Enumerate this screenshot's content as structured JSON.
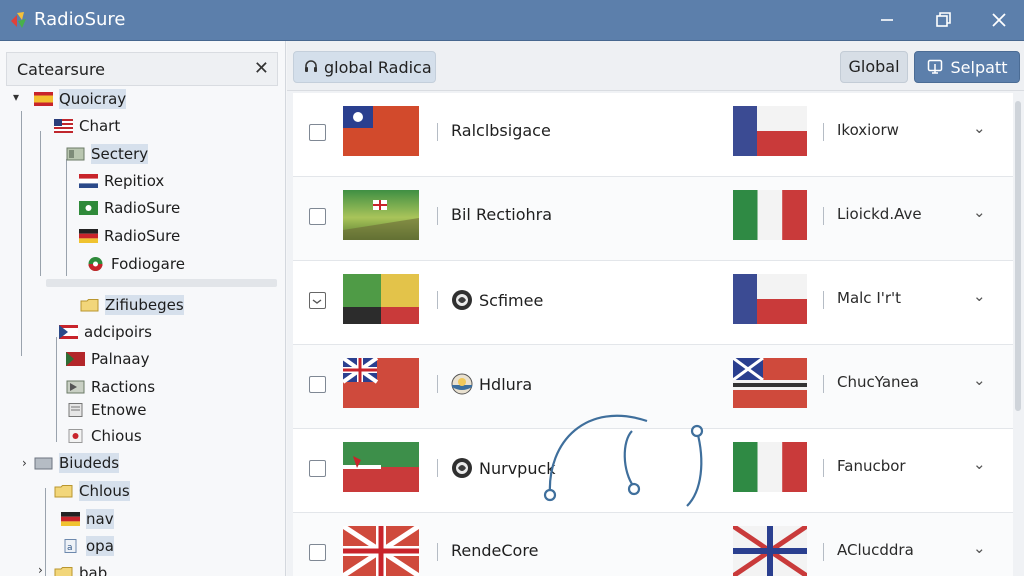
{
  "window": {
    "title": "RadioSure",
    "controls": [
      "minimize-icon",
      "restore-icon",
      "close-icon"
    ]
  },
  "sidebar": {
    "title": "Catearsure",
    "close_label": "✕",
    "items": [
      {
        "label": "Quoicray",
        "icon": "flag-es-icon"
      },
      {
        "label": "Chart",
        "icon": "flag-us-icon"
      },
      {
        "label": "Sectery",
        "icon": "folder-icon"
      },
      {
        "label": "Repitiox",
        "icon": "flag-nl-icon"
      },
      {
        "label": "RadioSure",
        "icon": "flag-green-icon"
      },
      {
        "label": "RadioSure",
        "icon": "flag-de-icon"
      },
      {
        "label": "Fodiogare",
        "icon": "flag-circle-icon"
      },
      {
        "label": "Zifiubeges",
        "icon": "folder-icon"
      },
      {
        "label": "adcipoirs",
        "icon": "flag-pr-icon"
      },
      {
        "label": "Palnaay",
        "icon": "flag-red-icon"
      },
      {
        "label": "Ractions",
        "icon": "folder-icon"
      },
      {
        "label": "Etnowe",
        "icon": "doc-icon"
      },
      {
        "label": "Chious",
        "icon": "doc-icon"
      },
      {
        "label": "Biudeds",
        "icon": "folder-icon"
      },
      {
        "label": "Chlous",
        "icon": "folder-icon"
      },
      {
        "label": "nav",
        "icon": "flag-de-icon"
      },
      {
        "label": "opa",
        "icon": "doc-icon"
      },
      {
        "label": "bab",
        "icon": "folder-icon"
      }
    ]
  },
  "toolbar": {
    "search_label": "global Radica",
    "global_label": "Global",
    "select_label": "Selpatt"
  },
  "stations": [
    {
      "name": "Ralclbsigace",
      "lang": "Ikoxiorw",
      "checked": false
    },
    {
      "name": "Bil Rectiohra",
      "lang": "Lioickd.Ave",
      "checked": false
    },
    {
      "name": "Scfimee",
      "lang": "Malc I'r't",
      "checked": "partial"
    },
    {
      "name": "Hdlura",
      "lang": "ChucYanea",
      "checked": false
    },
    {
      "name": "Nurvpuck",
      "lang": "Fanucbor",
      "checked": false
    },
    {
      "name": "RendeCore",
      "lang": "AClucddra",
      "checked": false
    }
  ],
  "colors": {
    "titlebar": "#5c7fab",
    "accent": "#5c7fab",
    "highlight": "#d6e0ec",
    "cursor_trail": "#3f6f9c"
  }
}
